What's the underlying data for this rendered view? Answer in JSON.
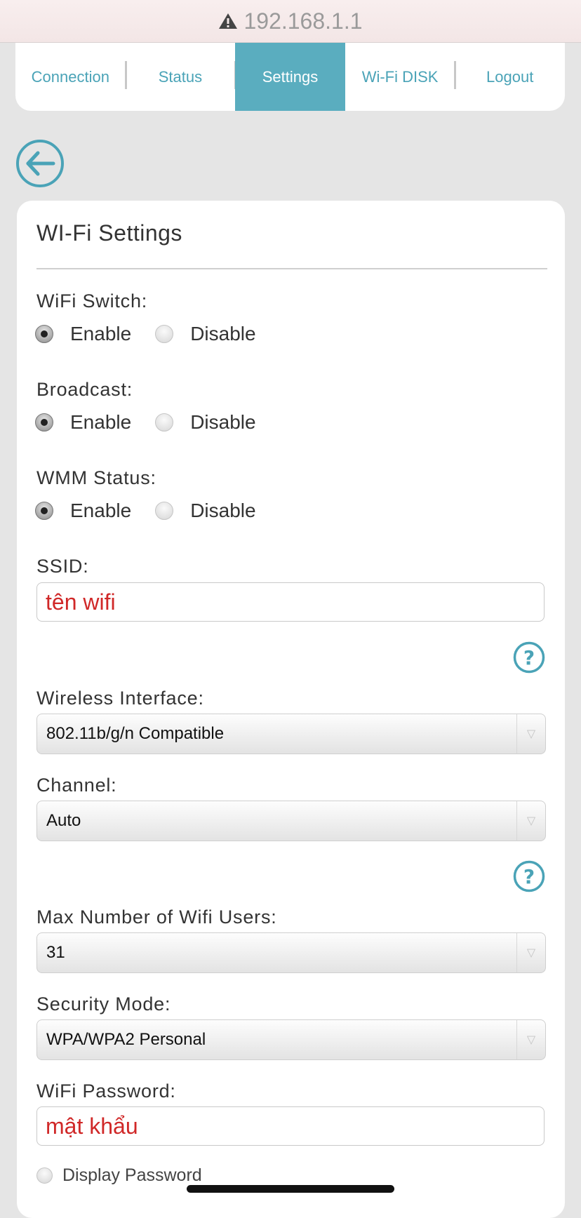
{
  "browser": {
    "url": "192.168.1.1",
    "warning_icon": "warning-triangle-icon"
  },
  "nav": {
    "items": [
      "Connection",
      "Status",
      "Settings",
      "Wi-Fi DISK",
      "Logout"
    ],
    "active": "Settings",
    "accent": "#5aadbf"
  },
  "back_icon": "arrow-left-circle-icon",
  "form": {
    "title": "WI-Fi Settings",
    "wifi_switch": {
      "label": "WiFi Switch:",
      "enable": "Enable",
      "disable": "Disable",
      "selected": "Enable"
    },
    "broadcast": {
      "label": "Broadcast:",
      "enable": "Enable",
      "disable": "Disable",
      "selected": "Enable"
    },
    "wmm": {
      "label": "WMM Status:",
      "enable": "Enable",
      "disable": "Disable",
      "selected": "Enable"
    },
    "ssid": {
      "label": "SSID:",
      "value": "tên wifi"
    },
    "wireless_interface": {
      "label": "Wireless Interface:",
      "value": "802.11b/g/n Compatible"
    },
    "channel": {
      "label": "Channel:",
      "value": "Auto"
    },
    "max_users": {
      "label": "Max Number of Wifi Users:",
      "value": "31"
    },
    "security_mode": {
      "label": "Security Mode:",
      "value": "WPA/WPA2 Personal"
    },
    "password": {
      "label": "WiFi Password:",
      "value": "mật khẩu"
    },
    "display_password": {
      "label": "Display Password",
      "checked": false
    }
  },
  "colors": {
    "annotation_red": "#d02828",
    "link_teal": "#4aa3b7"
  }
}
